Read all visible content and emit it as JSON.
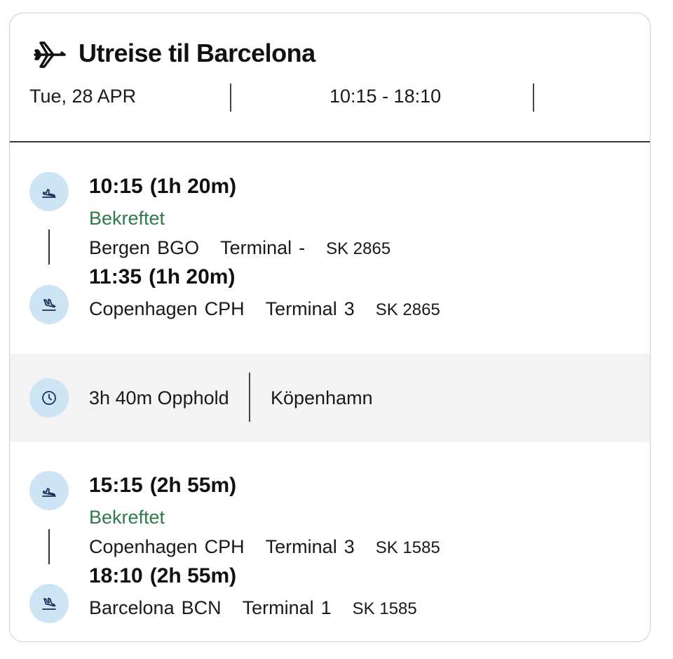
{
  "header": {
    "title": "Utreise til Barcelona",
    "date": "Tue, 28 APR",
    "time_range": "10:15 - 18:10"
  },
  "segments": [
    {
      "departure": {
        "time": "10:15",
        "duration": "(1h 20m)",
        "status": "Bekreftet",
        "city": "Bergen",
        "code": "BGO",
        "terminal_label": "Terminal",
        "terminal": "-",
        "flight": "SK 2865"
      },
      "arrival": {
        "time": "11:35",
        "duration": "(1h 20m)",
        "city": "Copenhagen",
        "code": "CPH",
        "terminal_label": "Terminal",
        "terminal": "3",
        "flight": "SK 2865"
      }
    },
    {
      "departure": {
        "time": "15:15",
        "duration": "(2h 55m)",
        "status": "Bekreftet",
        "city": "Copenhagen",
        "code": "CPH",
        "terminal_label": "Terminal",
        "terminal": "3",
        "flight": "SK 1585"
      },
      "arrival": {
        "time": "18:10",
        "duration": "(2h 55m)",
        "city": "Barcelona",
        "code": "BCN",
        "terminal_label": "Terminal",
        "terminal": "1",
        "flight": "SK 1585"
      }
    }
  ],
  "layover": {
    "duration_text": "3h 40m Opphold",
    "city": "Köpenhamn"
  },
  "icons": {
    "header": "airplane-icon",
    "departure": "takeoff-icon",
    "arrival": "landing-icon",
    "layover": "clock-icon"
  },
  "colors": {
    "status": "#2e7a4a",
    "icon_circle": "#cde4f4",
    "icon_stroke": "#1f2f5a",
    "layover_bg": "#f3f3f3"
  }
}
